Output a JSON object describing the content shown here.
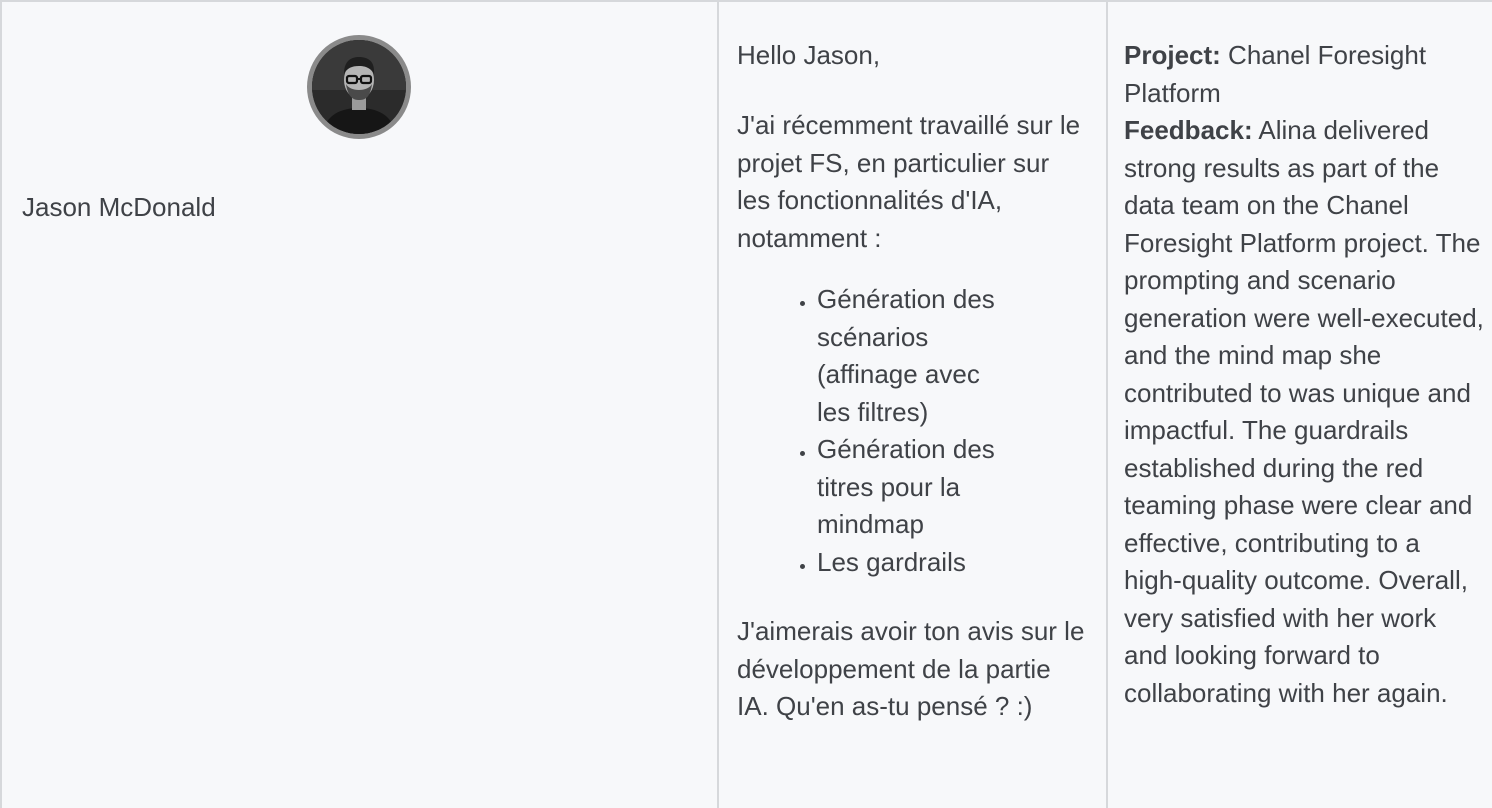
{
  "person": {
    "name": "Jason McDonald",
    "avatar_alt": "Jason McDonald"
  },
  "message": {
    "greeting": "Hello Jason,",
    "intro": "J'ai récemment travaillé sur le projet FS, en particulier sur les fonctionnalités d'IA, notamment :",
    "items": [
      "Génération des scénarios (affinage avec les filtres)",
      "Génération des titres pour la mindmap",
      "Les gardrails"
    ],
    "closing": "J'aimerais avoir ton avis sur le développement de la partie IA. Qu'en as-tu pensé ? :)"
  },
  "feedback": {
    "project_label": "Project:",
    "project_value": "Chanel Foresight Platform",
    "feedback_label": "Feedback:",
    "feedback_value": "Alina delivered strong results as part of the data team on the Chanel Foresight Platform project. The prompting and scenario generation were well-executed, and the mind map she contributed to was unique and impactful. The guardrails established during the red teaming phase were clear and effective, contributing to a high-quality outcome. Overall, very satisfied with her work and looking forward to collaborating with her again."
  },
  "colors": {
    "background": "#f7f8fa",
    "border": "#d6d8db",
    "text": "#3f4247",
    "avatar_ring": "#8a8a8a"
  }
}
